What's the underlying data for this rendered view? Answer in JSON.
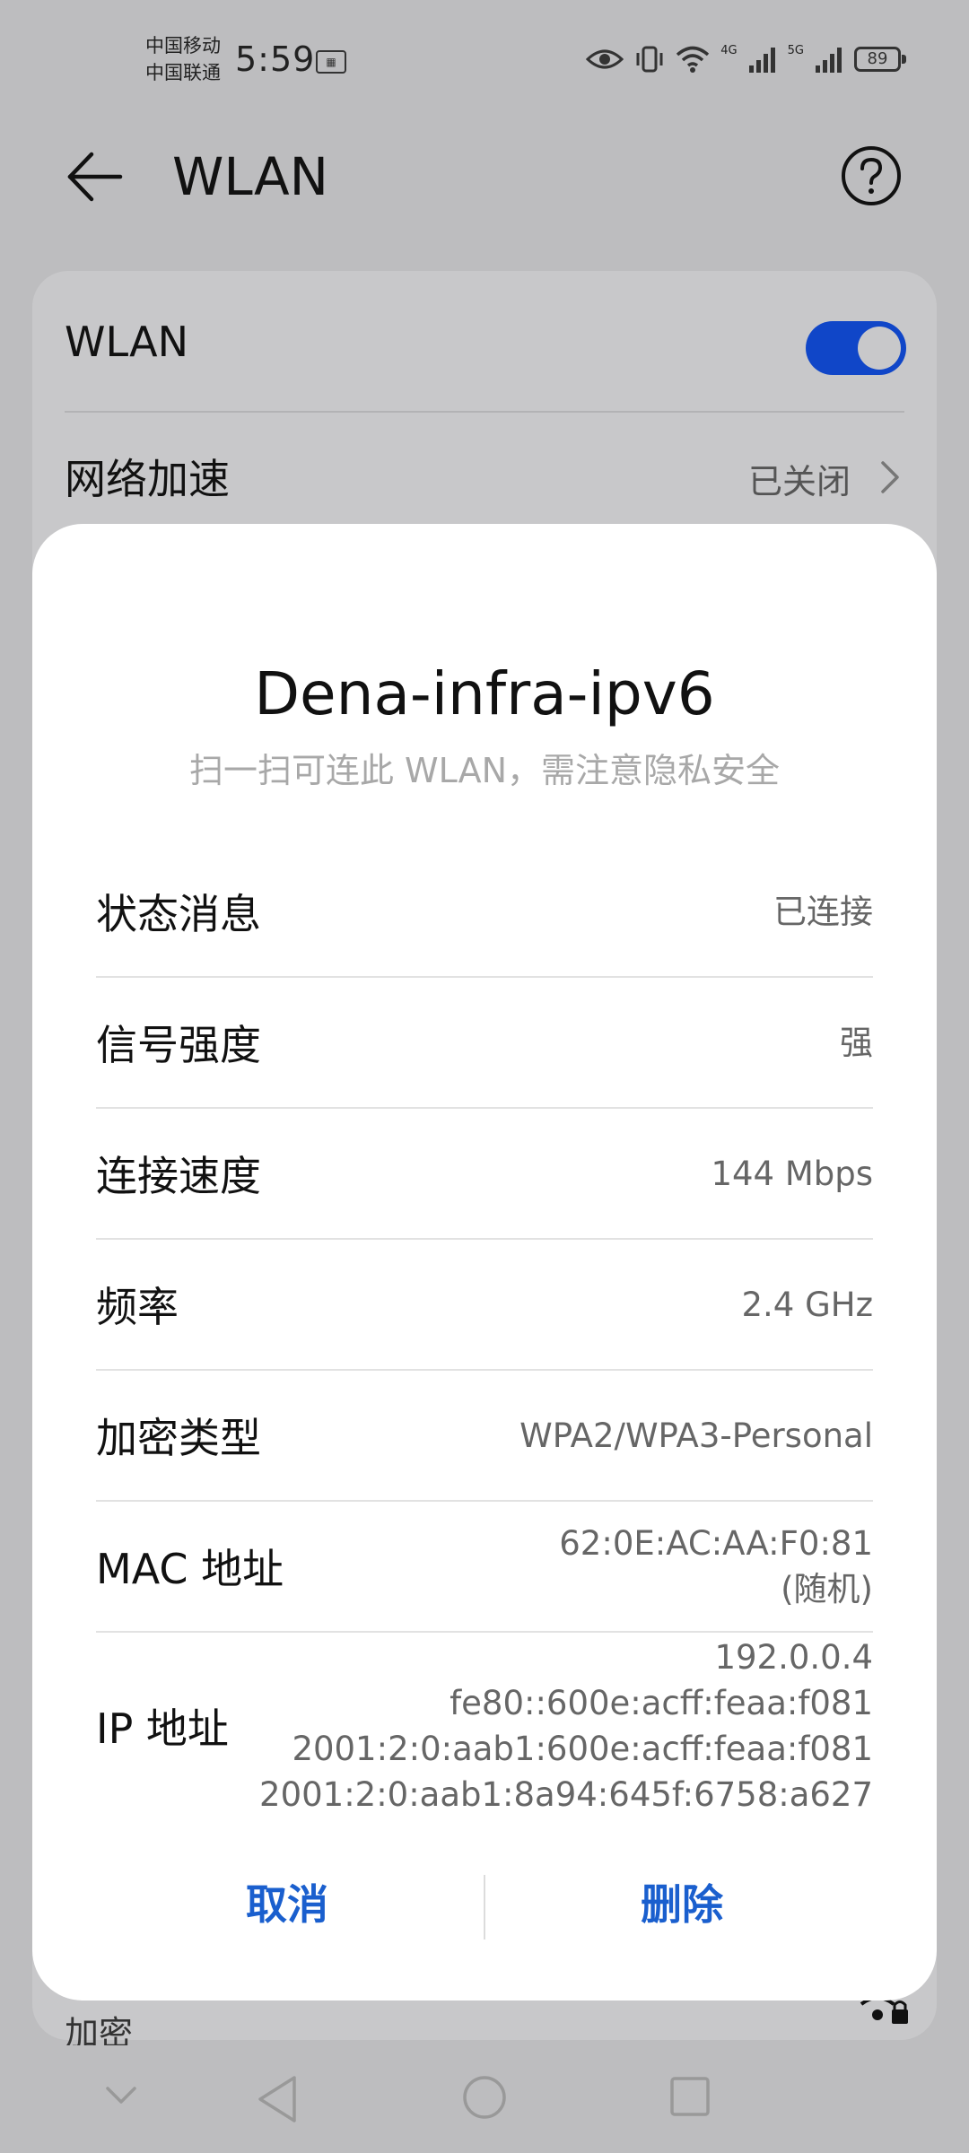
{
  "status_bar": {
    "carrier_1": "中国移动",
    "carrier_2": "中国联通",
    "time": "5:59",
    "network_1": "4G",
    "network_2": "5G",
    "battery": "89"
  },
  "header": {
    "title": "WLAN",
    "back_icon": "arrow-left-icon",
    "help_icon": "question-circle-icon"
  },
  "settings": {
    "wlan_label": "WLAN",
    "wlan_enabled": true,
    "accel_label": "网络加速",
    "accel_value": "已关闭",
    "encryption_label": "加密"
  },
  "dialog": {
    "title": "Dena-infra-ipv6",
    "subtitle": "扫一扫可连此 WLAN，需注意隐私安全",
    "rows": [
      {
        "label": "状态消息",
        "value": "已连接"
      },
      {
        "label": "信号强度",
        "value": "强"
      },
      {
        "label": "连接速度",
        "value": "144 Mbps"
      },
      {
        "label": "频率",
        "value": "2.4 GHz"
      },
      {
        "label": "加密类型",
        "value": "WPA2/WPA3-Personal"
      },
      {
        "label": "MAC 地址",
        "values": [
          "62:0E:AC:AA:F0:81",
          "(随机)"
        ]
      },
      {
        "label": "IP 地址",
        "values": [
          "192.0.0.4",
          "fe80::600e:acff:feaa:f081",
          "2001:2:0:aab1:600e:acff:feaa:f081",
          "2001:2:0:aab1:8a94:645f:6758:a627"
        ]
      }
    ],
    "cancel_label": "取消",
    "delete_label": "删除"
  },
  "colors": {
    "accent": "#1a5fce",
    "toggle_on": "#1046c8",
    "scrim": "#bdbdbf"
  }
}
